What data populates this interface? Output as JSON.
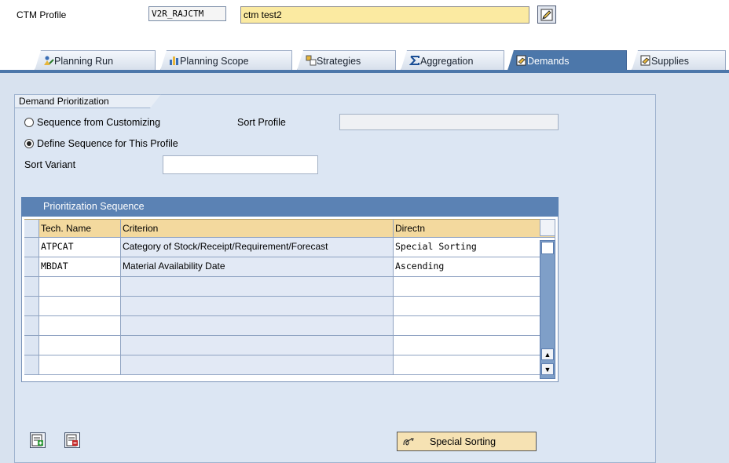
{
  "header": {
    "label": "CTM Profile",
    "code": "V2R_RAJCTM",
    "description": "ctm test2",
    "edit_icon": "edit-icon"
  },
  "tabs": [
    {
      "label": "Planning Run",
      "icon": "planning-run-icon",
      "active": false
    },
    {
      "label": "Planning Scope",
      "icon": "planning-scope-icon",
      "active": false
    },
    {
      "label": "Strategies",
      "icon": "strategies-icon",
      "active": false
    },
    {
      "label": "Aggregation",
      "icon": "sigma-icon",
      "active": false
    },
    {
      "label": "Demands",
      "icon": "demands-icon",
      "active": true
    },
    {
      "label": "Supplies",
      "icon": "supplies-icon",
      "active": false
    }
  ],
  "group": {
    "title": "Demand Prioritization",
    "radio_customizing": "Sequence from Customizing",
    "radio_define": "Define Sequence for This Profile",
    "sort_profile_label": "Sort Profile",
    "sort_profile_value": "",
    "sort_variant_label": "Sort Variant",
    "sort_variant_value": ""
  },
  "table": {
    "title": "Prioritization Sequence",
    "columns": [
      "Tech. Name",
      "Criterion",
      "Directn"
    ],
    "rows": [
      {
        "tech": "ATPCAT",
        "criterion": "Category of Stock/Receipt/Requirement/Forecast",
        "direction": "Special Sorting"
      },
      {
        "tech": "MBDAT",
        "criterion": "Material Availability Date",
        "direction": "Ascending"
      },
      {
        "tech": "",
        "criterion": "",
        "direction": ""
      },
      {
        "tech": "",
        "criterion": "",
        "direction": ""
      },
      {
        "tech": "",
        "criterion": "",
        "direction": ""
      },
      {
        "tech": "",
        "criterion": "",
        "direction": ""
      },
      {
        "tech": "",
        "criterion": "",
        "direction": ""
      }
    ]
  },
  "buttons": {
    "special_sorting": "Special Sorting"
  },
  "colors": {
    "tab_active": "#4c77aa",
    "panel_bg": "#d8e2ef",
    "header_input": "#fbeaa1",
    "table_header": "#f3d99e"
  }
}
